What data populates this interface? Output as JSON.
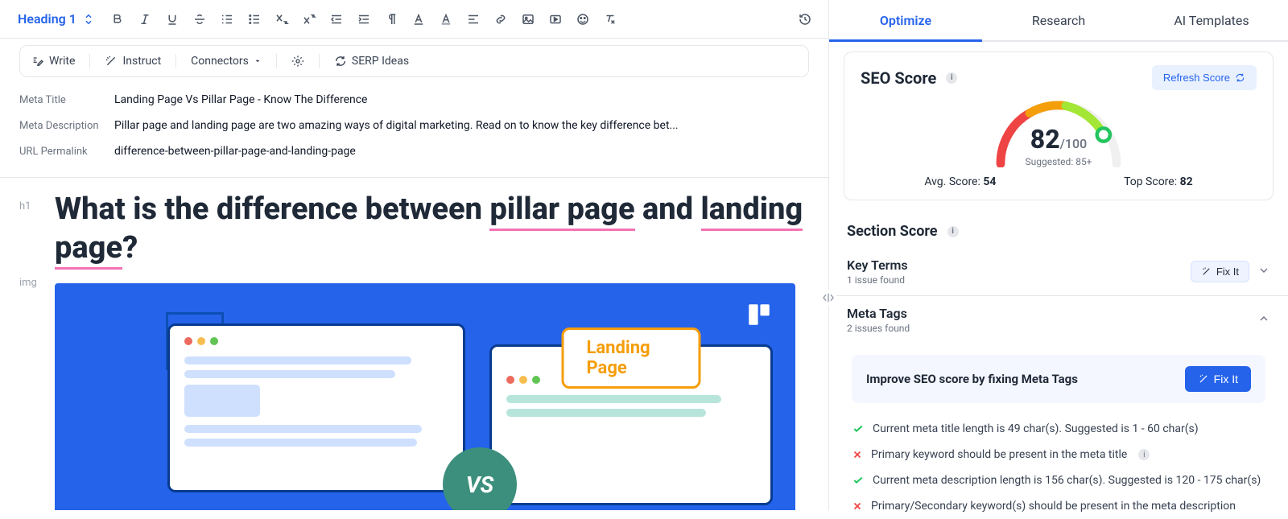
{
  "toolbar": {
    "heading_label": "Heading 1",
    "actions": {
      "write": "Write",
      "instruct": "Instruct",
      "connectors": "Connectors",
      "serp": "SERP Ideas"
    }
  },
  "meta": {
    "title_label": "Meta Title",
    "title_value": "Landing Page Vs Pillar Page - Know The Difference",
    "desc_label": "Meta Description",
    "desc_value": "Pillar page and landing page are two amazing ways of digital marketing. Read on to know the key difference bet...",
    "perm_label": "URL Permalink",
    "perm_value": "difference-between-pillar-page-and-landing-page"
  },
  "doc": {
    "h1_tag": "h1",
    "img_tag": "img",
    "title_plain_a": "What is the difference between ",
    "title_kw1": "pillar page",
    "title_mid": " and ",
    "title_kw2": "landing page",
    "title_end": "?",
    "hero_label": "Landing Page",
    "hero_vs": "VS"
  },
  "side": {
    "tabs": [
      "Optimize",
      "Research",
      "AI Templates"
    ],
    "seo_title": "SEO Score",
    "refresh": "Refresh Score",
    "score": "82",
    "score_denom": "/100",
    "suggested": "Suggested: 85+",
    "avg_label": "Avg. Score: ",
    "avg_val": "54",
    "top_label": "Top Score: ",
    "top_val": "82",
    "section_title": "Section Score",
    "key_terms": {
      "title": "Key Terms",
      "sub": "1 issue found",
      "fix": "Fix It"
    },
    "meta_tags": {
      "title": "Meta Tags",
      "sub": "2 issues found"
    },
    "callout": {
      "text": "Improve SEO score by fixing Meta Tags",
      "btn": "Fix It"
    },
    "checks": [
      {
        "ok": true,
        "text": "Current meta title length is 49 char(s). Suggested is 1 - 60 char(s)"
      },
      {
        "ok": false,
        "text": "Primary keyword should be present in the meta title",
        "info": true
      },
      {
        "ok": true,
        "text": "Current meta description length is 156 char(s). Suggested is 120 - 175 char(s)"
      },
      {
        "ok": false,
        "text": "Primary/Secondary keyword(s) should be present in the meta description"
      }
    ]
  }
}
